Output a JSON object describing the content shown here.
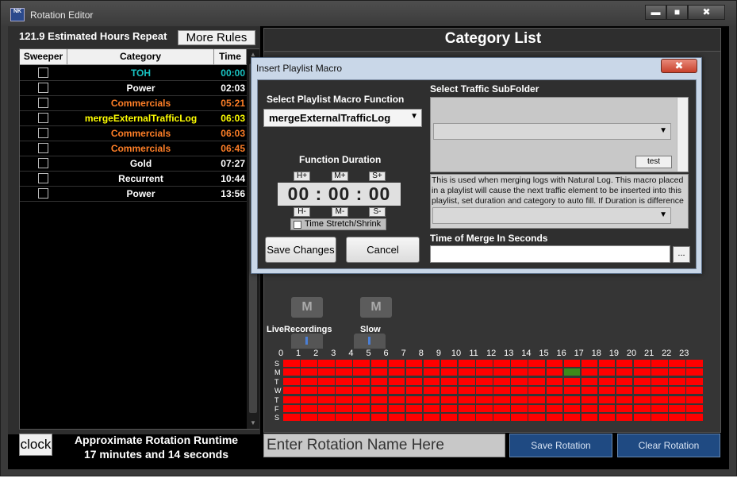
{
  "window": {
    "title": "Rotation Editor",
    "app_icon_text": "NK",
    "min_glyph": "▬",
    "max_glyph": "■",
    "close_glyph": "✖"
  },
  "left": {
    "estimated_hours": "121.9 Estimated Hours Repeat",
    "more_rules_label": "More Rules",
    "columns": [
      "Sweeper",
      "Category",
      "Time"
    ],
    "rows": [
      {
        "category": "TOH",
        "time": "00:00",
        "color": "#19c3c3"
      },
      {
        "category": "Power",
        "time": "02:03",
        "color": "#ffffff"
      },
      {
        "category": "Commercials",
        "time": "05:21",
        "color": "#ff7f27"
      },
      {
        "category": "mergeExternalTrafficLog",
        "time": "06:03",
        "color": "#ffff00"
      },
      {
        "category": "Commercials",
        "time": "06:03",
        "color": "#ff7f27"
      },
      {
        "category": "Commercials",
        "time": "06:45",
        "color": "#ff7f27"
      },
      {
        "category": "Gold",
        "time": "07:27",
        "color": "#ffffff"
      },
      {
        "category": "Recurrent",
        "time": "10:44",
        "color": "#ffffff"
      },
      {
        "category": "Power",
        "time": "13:56",
        "color": "#ffffff"
      }
    ],
    "clock_label": "clock",
    "runtime_line1": "Approximate Rotation Runtime",
    "runtime_line2": "17 minutes and 14 seconds"
  },
  "right": {
    "title": "Category List",
    "tiles": [
      {
        "label": "LiveRecordings",
        "icon": "M"
      },
      {
        "label": "Slow",
        "icon": "M"
      }
    ],
    "hours": [
      "0",
      "1",
      "2",
      "3",
      "4",
      "5",
      "6",
      "7",
      "8",
      "9",
      "10",
      "11",
      "12",
      "13",
      "14",
      "15",
      "16",
      "17",
      "18",
      "19",
      "20",
      "21",
      "22",
      "23"
    ],
    "days": [
      "S",
      "M",
      "T",
      "W",
      "T",
      "F",
      "S"
    ],
    "grid_color_off": "#ff0000",
    "grid_color_on": "#3d8a1a",
    "highlight_cell": {
      "day": 1,
      "hour": 16
    }
  },
  "bottom": {
    "rotation_name_placeholder": "Enter Rotation Name Here",
    "save_rotation_label": "Save Rotation",
    "clear_rotation_label": "Clear Rotation"
  },
  "dialog": {
    "title": "Insert Playlist Macro",
    "close_glyph": "✖",
    "select_function_label": "Select Playlist Macro Function",
    "function_value": "mergeExternalTrafficLog",
    "duration_label": "Function Duration",
    "h_plus": "H+",
    "m_plus": "M+",
    "s_plus": "S+",
    "h_minus": "H-",
    "m_minus": "M-",
    "s_minus": "S-",
    "duration_value": "00 : 00 : 00",
    "stretch_label": "Time Stretch/Shrink",
    "save_label": "Save Changes",
    "cancel_label": "Cancel",
    "subfolder_label": "Select Traffic SubFolder",
    "test_label": "test",
    "description": "This is used when merging logs with Natural Log. This macro placed in a playlist will cause the next traffic element to be inserted into this playlist, set duration and category to auto fill. If Duration is difference",
    "merge_label": "Time of Merge In Seconds",
    "browse_label": "...",
    "dropdown_glyph": "▼"
  }
}
